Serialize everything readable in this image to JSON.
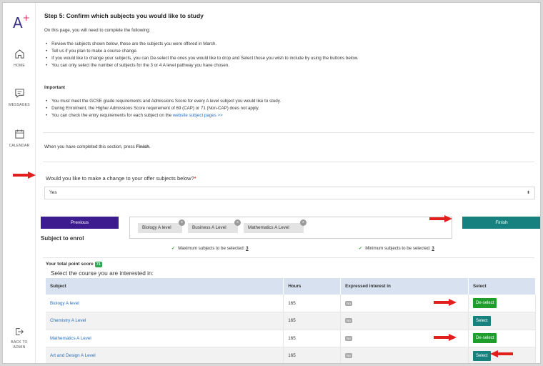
{
  "sidebar": {
    "logo": "A",
    "logo_plus": "+",
    "items": [
      {
        "label": "HOME",
        "icon": "home-icon"
      },
      {
        "label": "MESSAGES",
        "icon": "message-icon"
      },
      {
        "label": "CALENDAR",
        "icon": "calendar-icon"
      }
    ],
    "back": {
      "label_1": "BACK TO",
      "label_2": "ADMIN",
      "icon": "logout-icon"
    }
  },
  "main": {
    "title": "Step 5: Confirm which subjects you would like to study",
    "intro": "On this page, you will need to complete the following:",
    "bullets": [
      "Review the subjects shown below, these are the subjects you were offered in March.",
      "Tell us if you plan to make a course change.",
      "If you would like to change your subjects, you can De-select the ones you would like to drop and Select those you wish to include by using the buttons below.",
      "You can only select the number of subjects for the 3 or 4 A level pathway you have chosen."
    ],
    "important_heading": "Important",
    "important_bullets": [
      "You must meet the GCSE grade requirements and Admissions Score for every A level subject you would like to study.",
      "During Enrolment, the Higher Admissions Score requirement of 69 (CAP) or 71 (Non-CAP) does not apply."
    ],
    "link_bullet_prefix": "You can check the entry requirements for each subject on the ",
    "link_text": "website subject pages >>",
    "finish_note_prefix": "When you have completed this section, press ",
    "finish_note_bold": "Finish",
    "finish_note_suffix": ".",
    "question": "Would you like to make a change to your offer subjects below?",
    "question_required": "*",
    "answer": "Yes",
    "previous_label": "Previous",
    "finish_label": "Finish",
    "chips": [
      "Biology A level",
      "Business A Level",
      "Mathematics A Level"
    ],
    "chip_close": "x",
    "subject_to_enrol": "Subject to enrol",
    "max_rule_text": "Maximum subjects to be selected:",
    "max_rule_value": "3",
    "min_rule_text": "Minimum subjects to be selected:",
    "min_rule_value": "3",
    "score_label": "Your total point score",
    "score_value": "71",
    "course_prompt": "Select the course you are interested in:",
    "table": {
      "headers": [
        "Subject",
        "Hours",
        "Expressed interest in",
        "Select"
      ],
      "rows": [
        {
          "subject": "Biology A level",
          "hours": "165",
          "interest": "No",
          "select": "De-select"
        },
        {
          "subject": "Chemistry A Level",
          "hours": "165",
          "interest": "No",
          "select": "Select"
        },
        {
          "subject": "Mathematics A Level",
          "hours": "165",
          "interest": "No",
          "select": "De-select"
        },
        {
          "subject": "Art and Design A Level",
          "hours": "165",
          "interest": "No",
          "select": "Select"
        }
      ]
    }
  },
  "colors": {
    "brand_purple": "#3d1c8f",
    "teal": "#17817f",
    "green": "#1f9e2d",
    "arrow_red": "#e0201c",
    "link_blue": "#2a6fbd",
    "table_header": "#d7e1ef"
  }
}
